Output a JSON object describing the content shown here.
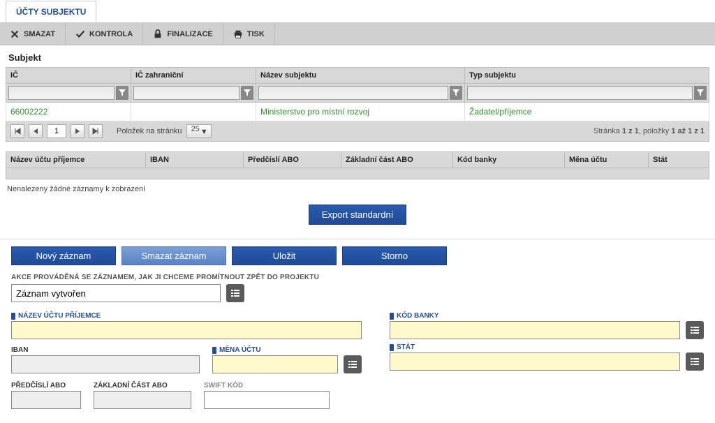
{
  "tab": {
    "title": "ÚČTY SUBJEKTU"
  },
  "toolbar": {
    "delete": "SMAZAT",
    "check": "KONTROLA",
    "finalize": "FINALIZACE",
    "print": "TISK"
  },
  "subject": {
    "heading": "Subjekt",
    "columns": {
      "ic": "IČ",
      "ic_foreign": "IČ zahraniční",
      "name": "Název subjektu",
      "type": "Typ subjektu"
    },
    "row": {
      "ic": "66002222",
      "ic_foreign": "",
      "name": "Ministerstvo pro místní rozvoj",
      "type": "Žadatel/příjemce"
    }
  },
  "paging": {
    "items_per_page_label": "Položek na stránku",
    "page": "1",
    "page_size": "25",
    "summary_prefix": "Stránka ",
    "summary_page": "1 z 1",
    "summary_items_prefix": ", položky ",
    "summary_items": "1 až 1 z 1"
  },
  "accounts": {
    "columns": {
      "name": "Název účtu příjemce",
      "iban": "IBAN",
      "prefix": "Předčíslí ABO",
      "base": "Základní část ABO",
      "bank_code": "Kód banky",
      "currency": "Měna účtu",
      "state": "Stát"
    },
    "no_records": "Nenalezeny žádné záznamy k zobrazení"
  },
  "export": {
    "label": "Export standardní"
  },
  "actions": {
    "new": "Nový záznam",
    "delete": "Smazat záznam",
    "save": "Uložit",
    "cancel": "Storno"
  },
  "form": {
    "action_label": "AKCE PROVÁDĚNÁ SE ZÁZNAMEM, JAK JI CHCEME PROMÍTNOUT ZPĚT DO PROJEKTU",
    "action_value": "Záznam vytvořen",
    "labels": {
      "account_name": "NÁZEV ÚČTU PŘÍJEMCE",
      "bank_code": "KÓD BANKY",
      "iban": "IBAN",
      "currency": "MĚNA ÚČTU",
      "state": "STÁT",
      "prefix": "PŘEDČÍSLÍ ABO",
      "base": "ZÁKLADNÍ ČÁST ABO",
      "swift": "SWIFT KÓD"
    },
    "values": {
      "account_name": "",
      "bank_code": "",
      "iban": "",
      "currency": "",
      "state": "",
      "prefix": "",
      "base": "",
      "swift": ""
    }
  }
}
